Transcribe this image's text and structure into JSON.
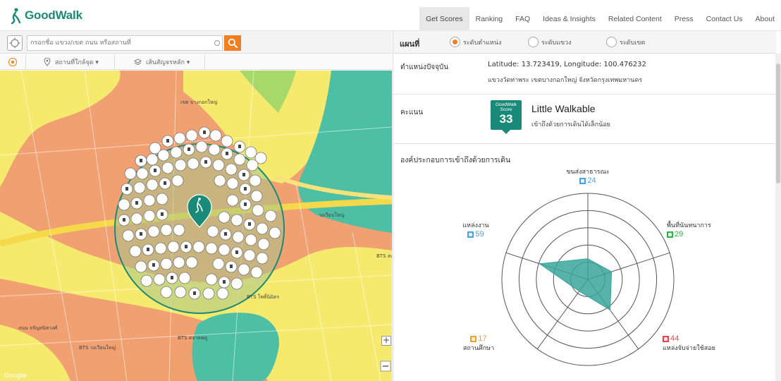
{
  "app": {
    "name": "GoodWalk"
  },
  "nav": {
    "items": [
      {
        "label": "Get Scores"
      },
      {
        "label": "Ranking"
      },
      {
        "label": "FAQ"
      },
      {
        "label": "Ideas & Insights"
      },
      {
        "label": "Related Content"
      },
      {
        "label": "Press"
      },
      {
        "label": "Contact Us"
      },
      {
        "label": "About"
      }
    ],
    "active": "Get Scores"
  },
  "search": {
    "placeholder": "กรอกชื่อ แขวง/เขต ถนน หรือสถานที่"
  },
  "filters": {
    "places_label": "สถานที่ใกล้จุด ▾",
    "route_label": "เส้นสัญจรหลัก ▾"
  },
  "map": {
    "labels": {
      "bts_west": "BTS วงเวียนใหญ่",
      "bts_mid": "BTS โพธิ์นิมิตร",
      "bts_low": "BTS ตลาดพลู",
      "bts_right": "BTS สะพาน",
      "district_top": "เขต บางกอกใหญ่",
      "hospital": "วงเวียนใหญ่",
      "road_left": "ถนน จรัญสนิทวงศ์",
      "watermark": "Google"
    }
  },
  "levels": {
    "label": "แผนที่",
    "options": [
      {
        "label": "ระดับตำแหน่ง",
        "selected": true
      },
      {
        "label": "ระดับแขวง",
        "selected": false
      },
      {
        "label": "ระดับเขต",
        "selected": false
      }
    ]
  },
  "location": {
    "label": "ตำแหน่งปัจจุบัน",
    "coords": "Latitude: 13.723419, Longitude: 100.476232",
    "address": "แขวงวัดท่าพระ เขตบางกอกใหญ่ จังหวัดกรุงเทพมหานคร"
  },
  "score": {
    "label": "คะแนน",
    "badge_title": "GoodWalk Score",
    "value": "33",
    "title": "Little Walkable",
    "description": "เข้าถึงด้วยการเดินได้เล็กน้อย"
  },
  "components": {
    "title": "องค์ประกอบการเข้าถึงด้วยการเดิน",
    "axes": [
      {
        "name": "ขนส่งสาธารณะ",
        "value": 24,
        "color": "#4aa3df"
      },
      {
        "name": "พื้นที่นันทนาการ",
        "value": 29,
        "color": "#2db34a"
      },
      {
        "name": "แหล่งจับจ่ายใช้สอย",
        "value": 44,
        "color": "#e0474c"
      },
      {
        "name": "สถานศึกษา",
        "value": 17,
        "color": "#f0a02e"
      },
      {
        "name": "แหล่งงาน",
        "value": 59,
        "color": "#4aa3df"
      }
    ]
  },
  "colors": {
    "brand": "#1a8a78",
    "accent": "#f07f1f",
    "radar_fill": "#3aa59a"
  },
  "icons": {
    "logo": "walking-person-icon",
    "locate": "crosshair-icon",
    "search": "search-icon",
    "pin": "location-pin-icon",
    "layers": "layers-icon"
  }
}
